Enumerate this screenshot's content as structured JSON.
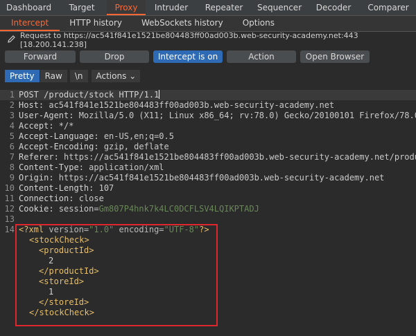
{
  "top_tabs": [
    "Dashboard",
    "Target",
    "Proxy",
    "Intruder",
    "Repeater",
    "Sequencer",
    "Decoder",
    "Comparer"
  ],
  "top_tabs_active": "Proxy",
  "sub_tabs": [
    "Intercept",
    "HTTP history",
    "WebSockets history",
    "Options"
  ],
  "sub_tabs_active": "Intercept",
  "request_info": "Request to https://ac541f841e1521be804483ff00ad003b.web-security-academy.net:443  [18.200.141.238]",
  "buttons": {
    "forward": "Forward",
    "drop": "Drop",
    "intercept": "Intercept is on",
    "action": "Action",
    "open_browser": "Open Browser"
  },
  "modes": {
    "pretty": "Pretty",
    "raw": "Raw",
    "newline": "\\n",
    "actions": "Actions"
  },
  "lines": {
    "l1": "POST /product/stock HTTP/1.1",
    "l2_k": "Host:",
    "l2_v": " ac541f841e1521be804483ff00ad003b.web-security-academy.net",
    "l3_k": "User-Agent:",
    "l3_v": " Mozilla/5.0 (X11; Linux x86_64; rv:78.0) Gecko/20100101 Firefox/78.0",
    "l4_k": "Accept:",
    "l4_v": " */*",
    "l5_k": "Accept-Language:",
    "l5_v": " en-US,en;q=0.5",
    "l6_k": "Accept-Encoding:",
    "l6_v": " gzip, deflate",
    "l7_k": "Referer:",
    "l7_v": " https://ac541f841e1521be804483ff00ad003b.web-security-academy.net/product",
    "l8_k": "Content-Type:",
    "l8_v": " application/xml",
    "l9_k": "Origin:",
    "l9_v": " https://ac541f841e1521be804483ff00ad003b.web-security-academy.net",
    "l10_k": "Content-Length:",
    "l10_v": " 107",
    "l11_k": "Connection:",
    "l11_v": " close",
    "l12_k": "Cookie:",
    "l12_n": " session",
    "l12_eq": "=",
    "l12_v": "Gm807P4hnk7k4LC0DCFLSV4LQIKPTADJ",
    "xml_open": "<?xml",
    "xml_version_attr": " version=",
    "xml_version_val": "\"1.0\"",
    "xml_enc_attr": " encoding=",
    "xml_enc_val": "\"UTF-8\"",
    "xml_close": "?>",
    "stockCheck_open": "<stockCheck>",
    "productId_open": "<productId>",
    "productId_val": "2",
    "productId_close": "</productId>",
    "storeId_open": "<storeId>",
    "storeId_val": "1",
    "storeId_close": "</storeId>",
    "stockCheck_close": "</stockCheck>"
  },
  "line_numbers": [
    "1",
    "2",
    "3",
    "4",
    "5",
    "6",
    "7",
    "8",
    "9",
    "10",
    "11",
    "12",
    "13",
    "14"
  ]
}
